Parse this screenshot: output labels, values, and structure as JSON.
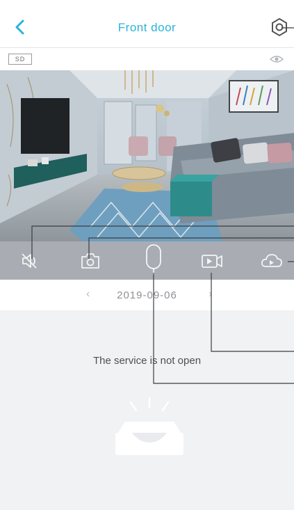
{
  "header": {
    "title": "Front door",
    "back_icon": "chevron-left-icon",
    "settings_icon": "gear-icon",
    "accent_color": "#2ab3d8"
  },
  "status": {
    "storage_badge": "SD",
    "visibility_icon": "eye-icon"
  },
  "controls": {
    "items": [
      {
        "icon": "speaker-muted-icon"
      },
      {
        "icon": "snapshot-icon"
      },
      {
        "icon": "microphone-icon"
      },
      {
        "icon": "record-video-icon"
      },
      {
        "icon": "cloud-icon"
      }
    ]
  },
  "playback": {
    "prev": "‹",
    "date": "2019-09-06",
    "next": "›"
  },
  "cloud_service": {
    "message": "The service is not open",
    "empty_icon": "empty-tray-icon"
  }
}
